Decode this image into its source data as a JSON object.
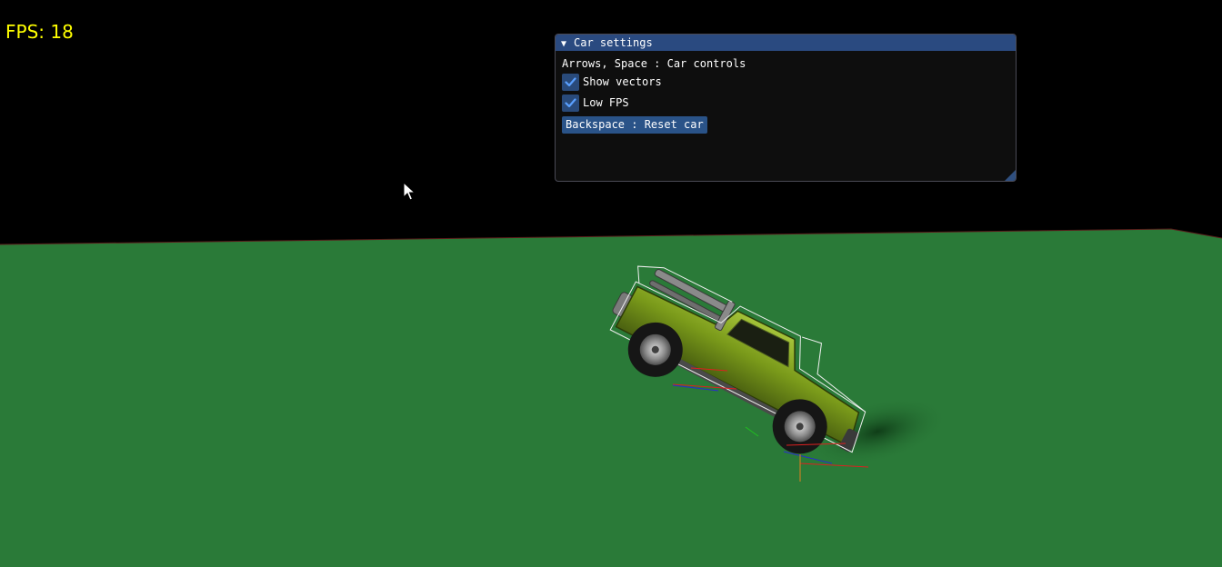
{
  "hud": {
    "fps_text": "FPS: 18"
  },
  "panel": {
    "title": "Car settings",
    "collapse_glyph": "▼",
    "controls_hint": "Arrows, Space : Car controls",
    "checkboxes": [
      {
        "label": "Show vectors",
        "checked": true
      },
      {
        "label": "Low FPS",
        "checked": true
      }
    ],
    "reset_button_label": "Backspace : Reset car"
  },
  "colors": {
    "ground": "#2a7a38",
    "sky": "#000000",
    "fps_text": "#ffff00",
    "panel_title_bg": "#2a4a80",
    "checkbox_bg": "#294a7a",
    "car_body": "#7a9a1a"
  },
  "icons": {
    "cursor": "arrow-cursor-icon",
    "checkmark": "checkmark-icon",
    "collapse": "triangle-down-icon"
  }
}
